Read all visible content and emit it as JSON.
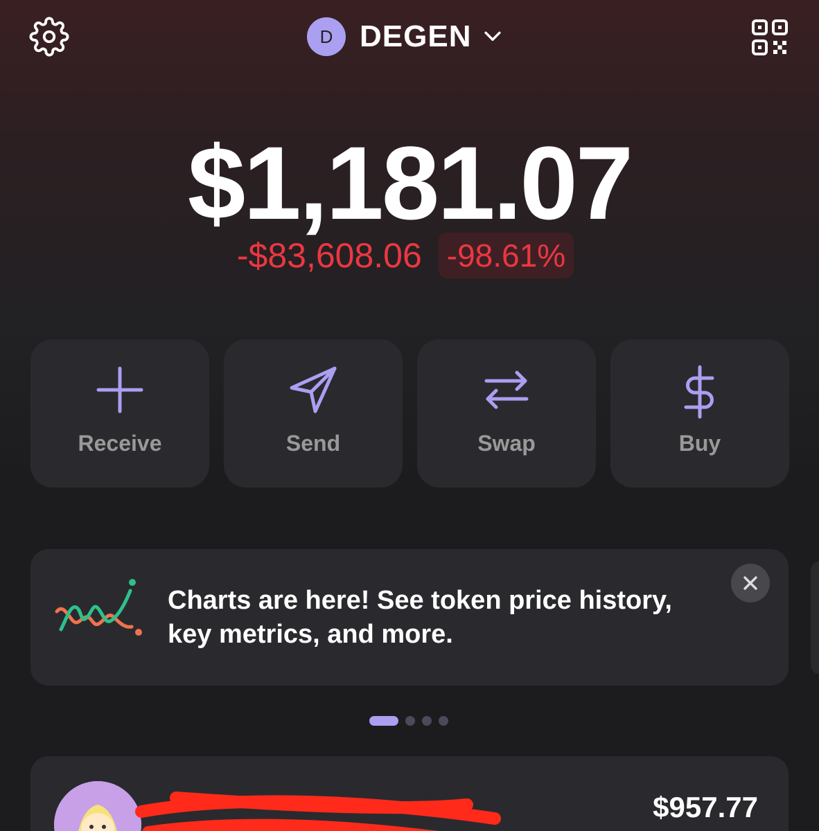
{
  "header": {
    "account_initial": "D",
    "account_name": "DEGEN",
    "settings_icon": "gear-icon",
    "qr_icon": "qr-code-icon"
  },
  "balance": {
    "total": "$1,181.07",
    "change_amount": "-$83,608.06",
    "change_percent": "-98.61%"
  },
  "actions": [
    {
      "label": "Receive",
      "icon": "plus-icon"
    },
    {
      "label": "Send",
      "icon": "send-icon"
    },
    {
      "label": "Swap",
      "icon": "swap-icon"
    },
    {
      "label": "Buy",
      "icon": "dollar-icon"
    }
  ],
  "promo": {
    "text": "Charts are here! See token price history, key metrics, and more.",
    "pages": 4,
    "active_page": 1
  },
  "token": {
    "value": "$957.77"
  },
  "colors": {
    "accent": "#ab9ff2",
    "negative": "#eb3742",
    "card": "#2a2a2e"
  }
}
